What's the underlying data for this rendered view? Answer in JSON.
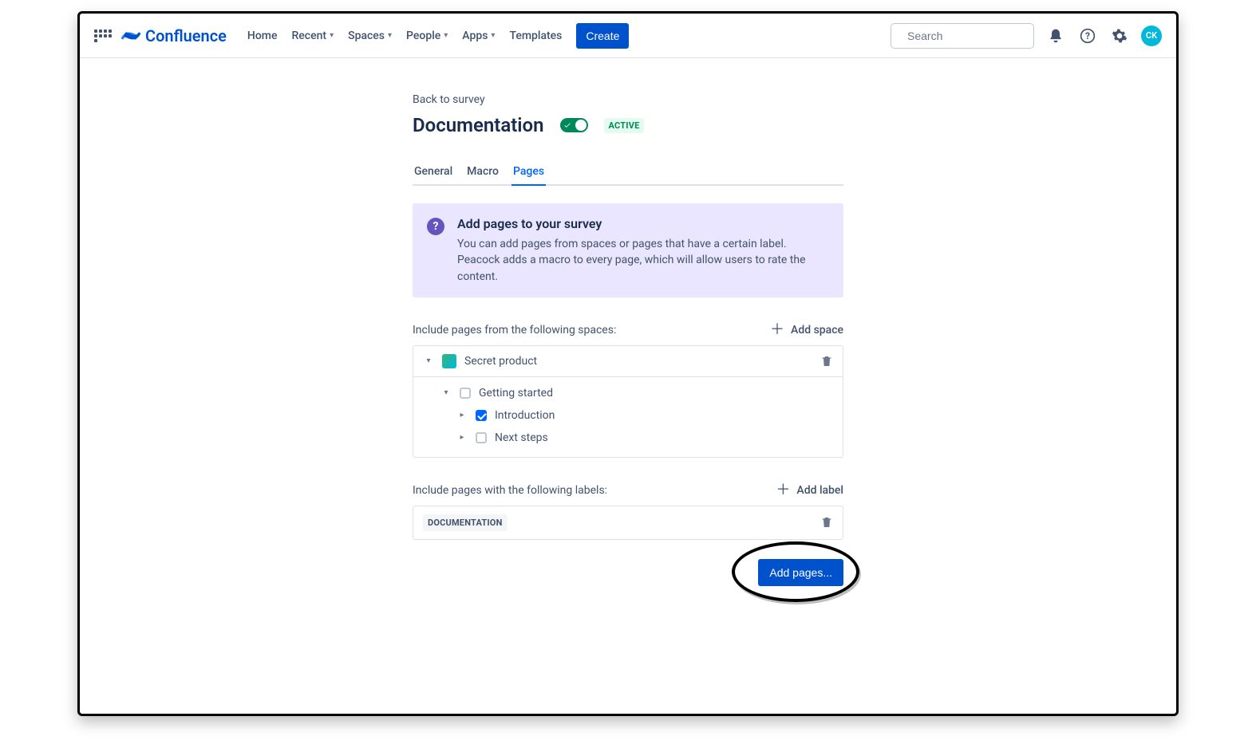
{
  "nav": {
    "logo_text": "Confluence",
    "items": {
      "home": "Home",
      "recent": "Recent",
      "spaces": "Spaces",
      "people": "People",
      "apps": "Apps",
      "templates": "Templates"
    },
    "create": "Create",
    "search_placeholder": "Search",
    "avatar_initials": "CK"
  },
  "page": {
    "back_link": "Back to survey",
    "title": "Documentation",
    "status_badge": "ACTIVE",
    "tabs": {
      "general": "General",
      "macro": "Macro",
      "pages": "Pages"
    },
    "info": {
      "title": "Add pages to your survey",
      "body": "You can add pages from spaces or pages that have a certain label. Peacock adds a macro to every page, which will allow users to rate the content."
    },
    "spaces_section": {
      "label": "Include pages from the following spaces:",
      "add_link": "Add space",
      "space_name": "Secret product",
      "tree": {
        "root": "Getting started",
        "child1": "Introduction",
        "child2": "Next steps"
      }
    },
    "labels_section": {
      "label": "Include pages with the following labels:",
      "add_link": "Add label",
      "chip": "DOCUMENTATION"
    },
    "add_pages_button": "Add pages..."
  }
}
